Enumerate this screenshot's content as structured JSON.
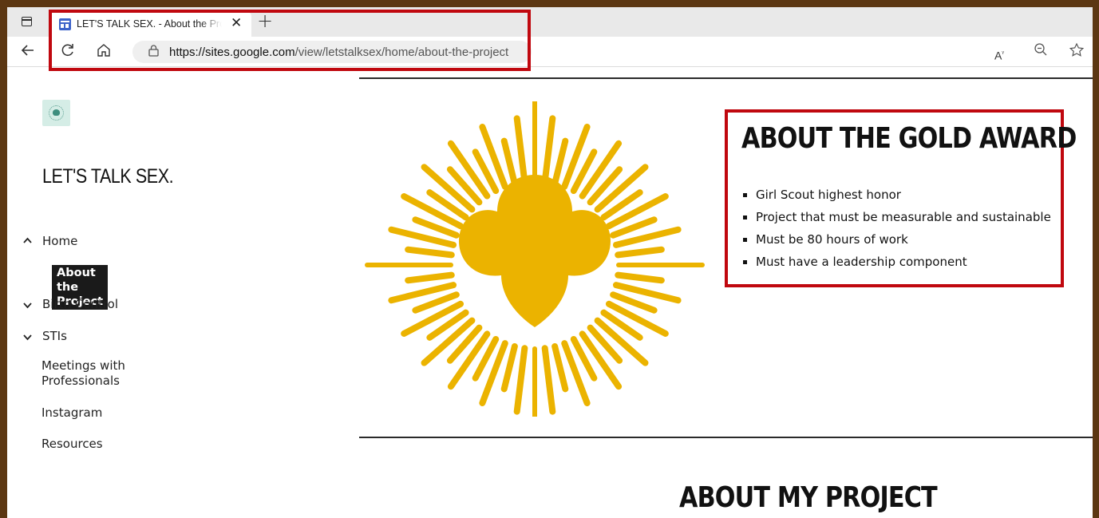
{
  "browser": {
    "tab_title": "LET'S TALK SEX. - About the Project",
    "tab_close": "✕",
    "new_tab": "+",
    "url_host": "https://sites.google.com",
    "url_path": "/view/letstalksex/home/about-the-project",
    "icons": [
      "window-icon",
      "site-favicon",
      "back-icon",
      "refresh-icon",
      "home-icon",
      "lock-icon",
      "read-aloud-icon",
      "zoom-icon",
      "favorite-icon"
    ]
  },
  "site": {
    "title": "LET'S TALK SEX."
  },
  "nav": {
    "home": "Home",
    "about": "About the Project",
    "birth_control": "Birth Control",
    "stis": "STIs",
    "meetings_line1": "Meetings with",
    "meetings_line2": "Professionals",
    "instagram": "Instagram",
    "resources": "Resources"
  },
  "gold_award": {
    "heading": "ABOUT THE GOLD AWARD",
    "items": [
      "Girl Scout highest honor",
      "Project that must be measurable and sustainable",
      "Must be 80 hours of work",
      "Must have a leadership component"
    ]
  },
  "project": {
    "heading": "ABOUT MY PROJECT"
  },
  "colors": {
    "emblem_gold": "#ebb300",
    "highlight_red": "#c0080f",
    "border_brown": "#5c3712"
  }
}
